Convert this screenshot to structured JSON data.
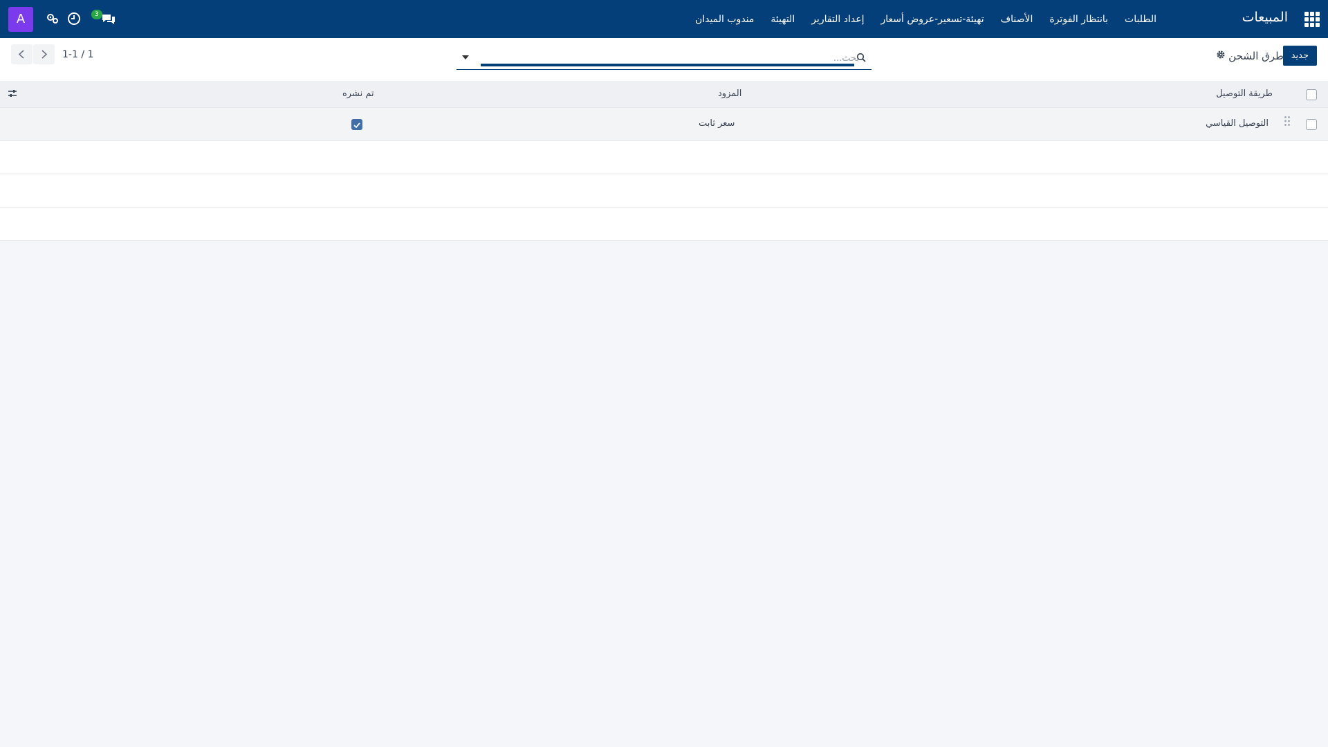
{
  "navbar": {
    "brand": "المبيعات",
    "menu": [
      "الطلبات",
      "بانتظار الفوترة",
      "الأصناف",
      "تهيئة-تسعير-عروض أسعار",
      "إعداد التقارير",
      "التهيئة",
      "مندوب الميدان"
    ],
    "avatar_letter": "A",
    "messages_badge": "3"
  },
  "control_panel": {
    "new_button": "جديد",
    "title": "طرق الشحن",
    "search_placeholder": "بحث...",
    "pager": "1-1 / 1"
  },
  "list": {
    "columns": [
      "طريقة التوصيل",
      "المزود",
      "تم نشره"
    ],
    "rows": [
      {
        "delivery_method": "التوصيل القياسي",
        "provider": "سعر ثابت",
        "published": true
      }
    ]
  },
  "colors": {
    "navbar": "#053f7a",
    "avatar": "#7c3aed",
    "badge": "#28a745"
  }
}
